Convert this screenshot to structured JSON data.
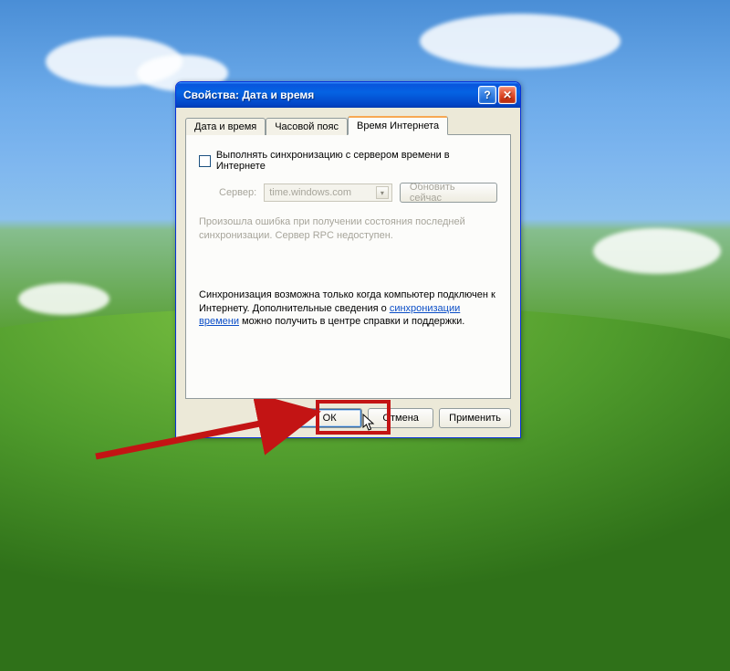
{
  "window": {
    "title": "Свойства: Дата и время"
  },
  "tabs": {
    "date_time": "Дата и время",
    "timezone": "Часовой пояс",
    "internet_time": "Время Интернета"
  },
  "panel": {
    "sync_checkbox_label": "Выполнять синхронизацию с сервером времени в Интернете",
    "server_label": "Сервер:",
    "server_value": "time.windows.com",
    "update_now": "Обновить сейчас",
    "status_line1": "Произошла ошибка при получении состояния последней",
    "status_line2": "синхронизации. Сервер RPC недоступен.",
    "info_pre": "Синхронизация возможна только когда компьютер подключен к Интернету. Дополнительные сведения о ",
    "info_link": "синхронизации времени",
    "info_post": " можно получить в центре справки и поддержки."
  },
  "buttons": {
    "ok": "ОК",
    "cancel": "Отмена",
    "apply": "Применить"
  }
}
